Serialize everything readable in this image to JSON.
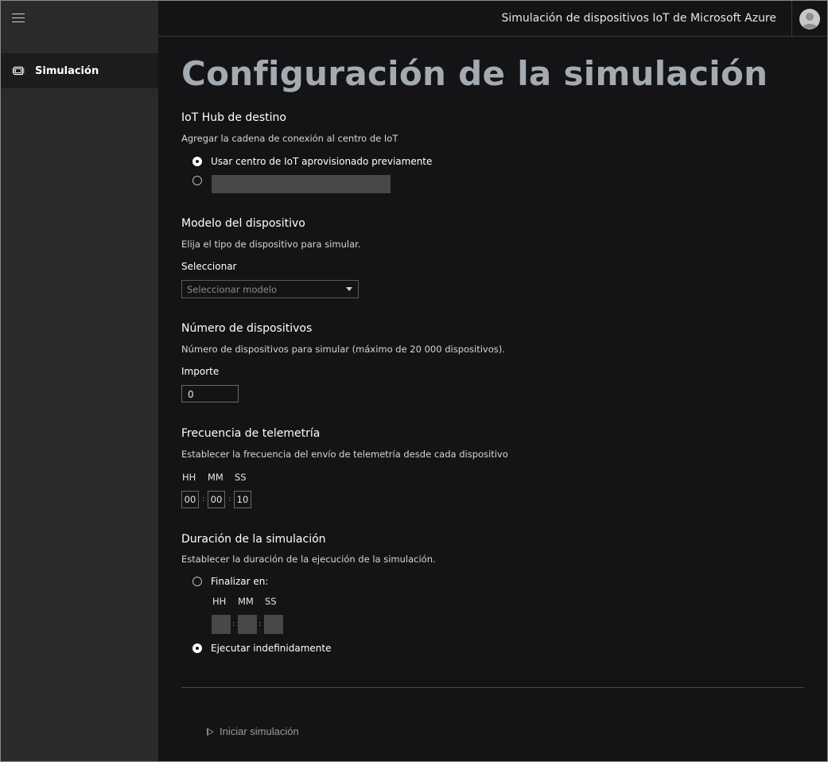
{
  "header": {
    "title": "Simulación de dispositivos IoT de Microsoft Azure"
  },
  "sidebar": {
    "items": [
      {
        "label": "Simulación",
        "icon": "chip-icon",
        "selected": true
      }
    ]
  },
  "page": {
    "title": "Configuración de la simulación"
  },
  "iot_hub": {
    "title": "IoT Hub de destino",
    "description": "Agregar la cadena de conexión al centro de IoT",
    "option_preprovisioned": "Usar centro de IoT aprovisionado previamente",
    "connection_string_value": ""
  },
  "device_model": {
    "title": "Modelo del dispositivo",
    "description": "Elija el tipo de dispositivo para simular.",
    "select_label": "Seleccionar",
    "select_placeholder": "Seleccionar modelo"
  },
  "device_count": {
    "title": "Número de dispositivos",
    "description": "Número de dispositivos para simular (máximo de 20 000 dispositivos).",
    "amount_label": "Importe",
    "amount_value": "0"
  },
  "telemetry": {
    "title": "Frecuencia de telemetría",
    "description": "Establecer la frecuencia del envío de telemetría desde cada dispositivo",
    "hh_label": "HH",
    "mm_label": "MM",
    "ss_label": "SS",
    "hh": "00",
    "mm": "00",
    "ss": "10",
    "sep": ":"
  },
  "duration": {
    "title": "Duración de la simulación",
    "description": "Establecer la duración de la ejecución de la simulación.",
    "option_end_at": "Finalizar en:",
    "hh_label": "HH",
    "mm_label": "MM",
    "ss_label": "SS",
    "sep": ":",
    "option_indefinite": "Ejecutar indefinidamente"
  },
  "actions": {
    "start_label": "Iniciar simulación"
  },
  "colors": {
    "background": "#141416",
    "sidebar": "#2a2a2c",
    "title": "#a3aab2"
  }
}
